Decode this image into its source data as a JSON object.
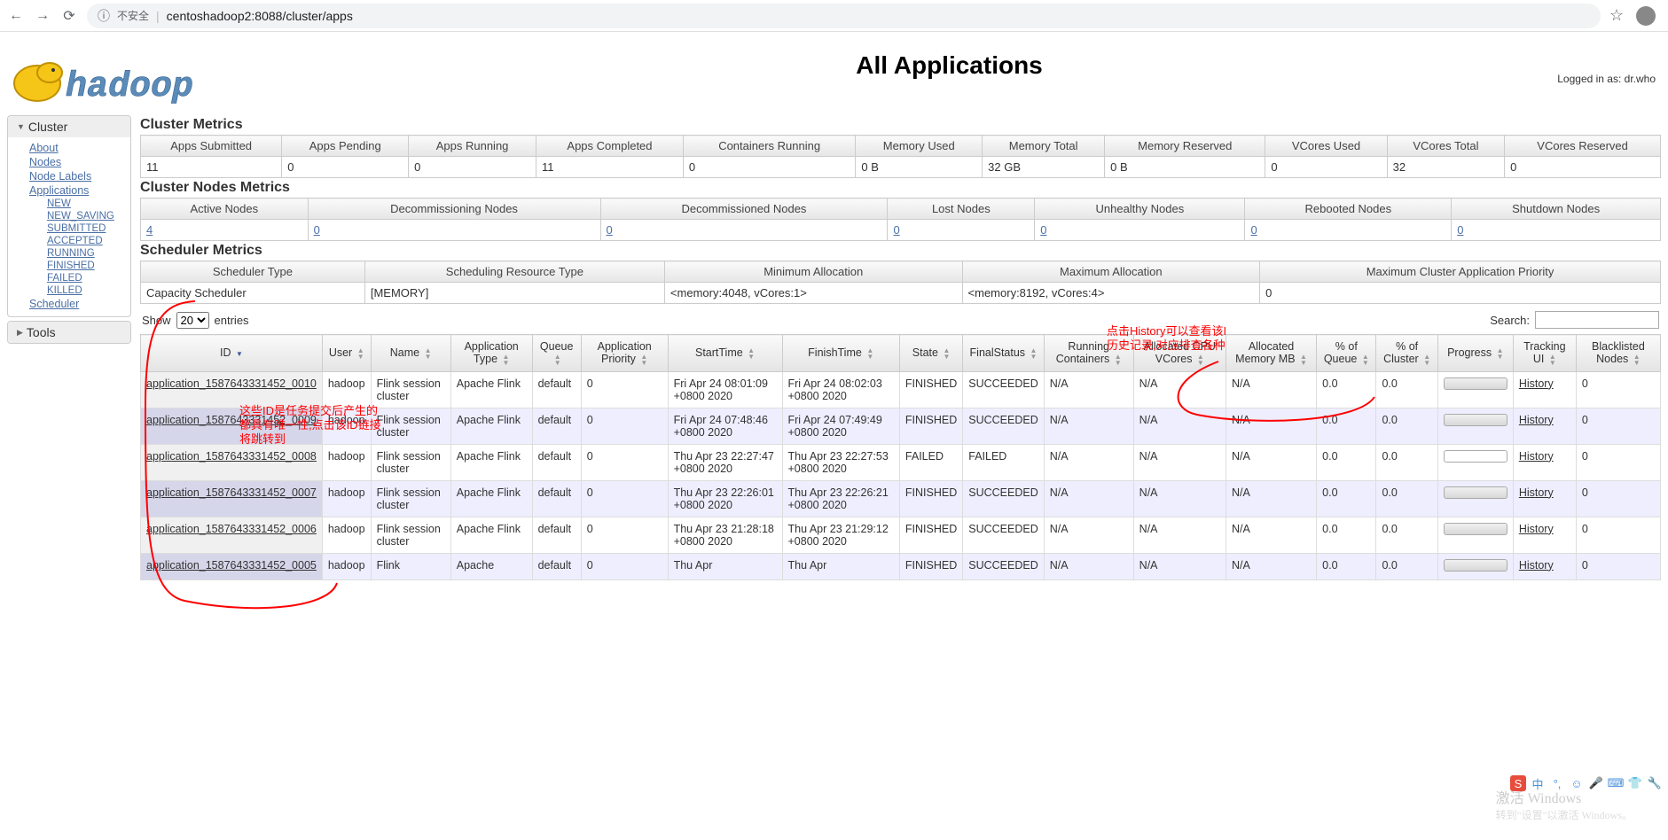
{
  "browser": {
    "insecure": "不安全",
    "url": "centoshadoop2:8088/cluster/apps"
  },
  "login_info": "Logged in as: dr.who",
  "page_title": "All Applications",
  "sidebar": {
    "cluster_head": "Cluster",
    "cluster_links": [
      "About",
      "Nodes",
      "Node Labels",
      "Applications"
    ],
    "app_states": [
      "NEW",
      "NEW_SAVING",
      "SUBMITTED",
      "ACCEPTED",
      "RUNNING",
      "FINISHED",
      "FAILED",
      "KILLED"
    ],
    "scheduler": "Scheduler",
    "tools_head": "Tools"
  },
  "headings": {
    "cluster_metrics": "Cluster Metrics",
    "nodes_metrics": "Cluster Nodes Metrics",
    "sched_metrics": "Scheduler Metrics"
  },
  "cluster_metrics": {
    "headers": [
      "Apps Submitted",
      "Apps Pending",
      "Apps Running",
      "Apps Completed",
      "Containers Running",
      "Memory Used",
      "Memory Total",
      "Memory Reserved",
      "VCores Used",
      "VCores Total",
      "VCores Reserved"
    ],
    "values": [
      "11",
      "0",
      "0",
      "11",
      "0",
      "0 B",
      "32 GB",
      "0 B",
      "0",
      "32",
      "0"
    ]
  },
  "nodes_metrics": {
    "headers": [
      "Active Nodes",
      "Decommissioning Nodes",
      "Decommissioned Nodes",
      "Lost Nodes",
      "Unhealthy Nodes",
      "Rebooted Nodes",
      "Shutdown Nodes"
    ],
    "values": [
      "4",
      "0",
      "0",
      "0",
      "0",
      "0",
      "0"
    ]
  },
  "sched_metrics": {
    "headers": [
      "Scheduler Type",
      "Scheduling Resource Type",
      "Minimum Allocation",
      "Maximum Allocation",
      "Maximum Cluster Application Priority"
    ],
    "values": [
      "Capacity Scheduler",
      "[MEMORY]",
      "<memory:4048, vCores:1>",
      "<memory:8192, vCores:4>",
      "0"
    ]
  },
  "show_label_pre": "Show",
  "show_options": [
    "20"
  ],
  "show_label_post": "entries",
  "search_label": "Search:",
  "app_headers": [
    "ID",
    "User",
    "Name",
    "Application Type",
    "Queue",
    "Application Priority",
    "StartTime",
    "FinishTime",
    "State",
    "FinalStatus",
    "Running Containers",
    "Allocated CPU VCores",
    "Allocated Memory MB",
    "% of Queue",
    "% of Cluster",
    "Progress",
    "Tracking UI",
    "Blacklisted Nodes"
  ],
  "apps": [
    {
      "id": "application_1587643331452_0010",
      "user": "hadoop",
      "name": "Flink session cluster",
      "type": "Apache Flink",
      "queue": "default",
      "prio": "0",
      "start": "Fri Apr 24 08:01:09 +0800 2020",
      "finish": "Fri Apr 24 08:02:03 +0800 2020",
      "state": "FINISHED",
      "final": "SUCCEEDED",
      "rc": "N/A",
      "cpu": "N/A",
      "mem": "N/A",
      "pq": "0.0",
      "pc": "0.0",
      "track": "History",
      "bl": "0",
      "pfull": true
    },
    {
      "id": "application_1587643331452_0009",
      "user": "hadoop",
      "name": "Flink session cluster",
      "type": "Apache Flink",
      "queue": "default",
      "prio": "0",
      "start": "Fri Apr 24 07:48:46 +0800 2020",
      "finish": "Fri Apr 24 07:49:49 +0800 2020",
      "state": "FINISHED",
      "final": "SUCCEEDED",
      "rc": "N/A",
      "cpu": "N/A",
      "mem": "N/A",
      "pq": "0.0",
      "pc": "0.0",
      "track": "History",
      "bl": "0",
      "pfull": true
    },
    {
      "id": "application_1587643331452_0008",
      "user": "hadoop",
      "name": "Flink session cluster",
      "type": "Apache Flink",
      "queue": "default",
      "prio": "0",
      "start": "Thu Apr 23 22:27:47 +0800 2020",
      "finish": "Thu Apr 23 22:27:53 +0800 2020",
      "state": "FAILED",
      "final": "FAILED",
      "rc": "N/A",
      "cpu": "N/A",
      "mem": "N/A",
      "pq": "0.0",
      "pc": "0.0",
      "track": "History",
      "bl": "0",
      "pfull": false
    },
    {
      "id": "application_1587643331452_0007",
      "user": "hadoop",
      "name": "Flink session cluster",
      "type": "Apache Flink",
      "queue": "default",
      "prio": "0",
      "start": "Thu Apr 23 22:26:01 +0800 2020",
      "finish": "Thu Apr 23 22:26:21 +0800 2020",
      "state": "FINISHED",
      "final": "SUCCEEDED",
      "rc": "N/A",
      "cpu": "N/A",
      "mem": "N/A",
      "pq": "0.0",
      "pc": "0.0",
      "track": "History",
      "bl": "0",
      "pfull": true
    },
    {
      "id": "application_1587643331452_0006",
      "user": "hadoop",
      "name": "Flink session cluster",
      "type": "Apache Flink",
      "queue": "default",
      "prio": "0",
      "start": "Thu Apr 23 21:28:18 +0800 2020",
      "finish": "Thu Apr 23 21:29:12 +0800 2020",
      "state": "FINISHED",
      "final": "SUCCEEDED",
      "rc": "N/A",
      "cpu": "N/A",
      "mem": "N/A",
      "pq": "0.0",
      "pc": "0.0",
      "track": "History",
      "bl": "0",
      "pfull": true
    },
    {
      "id": "application_1587643331452_0005",
      "user": "hadoop",
      "name": "Flink",
      "type": "Apache",
      "queue": "default",
      "prio": "0",
      "start": "Thu Apr",
      "finish": "Thu Apr",
      "state": "FINISHED",
      "final": "SUCCEEDED",
      "rc": "N/A",
      "cpu": "N/A",
      "mem": "N/A",
      "pq": "0.0",
      "pc": "0.0",
      "track": "History",
      "bl": "0",
      "pfull": true
    }
  ],
  "annotations": {
    "left1": "这些ID是任务提交后产生的",
    "left2": "都具有唯一性,点击该ID链接",
    "left3": "将跳转到",
    "right1": "点击History可以查看该I",
    "right2": "历史记录,对应排查各种"
  },
  "watermark": {
    "l1": "激活 Windows",
    "l2": "转到\"设置\"以激活 Windows。"
  }
}
